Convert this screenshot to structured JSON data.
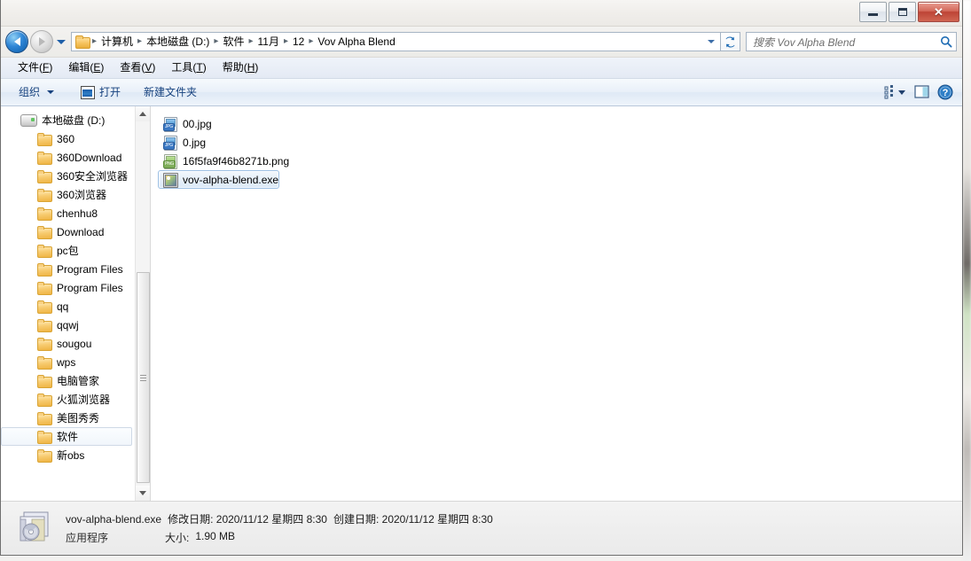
{
  "window": {
    "title": "",
    "controls": {
      "minimize": "—",
      "maximize": "❐",
      "close": "✕"
    }
  },
  "navigation": {
    "back_label": "后退",
    "forward_label": "前进",
    "history_label": "最近的位置",
    "refresh_label": "刷新",
    "breadcrumb_separator": "▸",
    "breadcrumbs": [
      "计算机",
      "本地磁盘 (D:)",
      "软件",
      "11月",
      "12",
      "Vov Alpha Blend"
    ]
  },
  "search": {
    "placeholder": "搜索 Vov Alpha Blend",
    "value": ""
  },
  "menubar": {
    "items": [
      {
        "text": "文件(F)",
        "pre": "文件(",
        "key": "F",
        "post": ")"
      },
      {
        "text": "编辑(E)",
        "pre": "编辑(",
        "key": "E",
        "post": ")"
      },
      {
        "text": "查看(V)",
        "pre": "查看(",
        "key": "V",
        "post": ")"
      },
      {
        "text": "工具(T)",
        "pre": "工具(",
        "key": "T",
        "post": ")"
      },
      {
        "text": "帮助(H)",
        "pre": "帮助(",
        "key": "H",
        "post": ")"
      }
    ]
  },
  "toolbar": {
    "organize_label": "组织",
    "open_label": "打开",
    "new_folder_label": "新建文件夹",
    "view_label": "更改您的视图",
    "preview_label": "显示预览窗格",
    "help_label": "获取帮助"
  },
  "sidebar": {
    "root": {
      "label": "本地磁盘 (D:)",
      "icon": "drive-icon"
    },
    "items": [
      {
        "label": "360",
        "selected": false
      },
      {
        "label": "360Download",
        "selected": false
      },
      {
        "label": "360安全浏览器",
        "selected": false
      },
      {
        "label": "360浏览器",
        "selected": false
      },
      {
        "label": "chenhu8",
        "selected": false
      },
      {
        "label": "Download",
        "selected": false
      },
      {
        "label": "pc包",
        "selected": false
      },
      {
        "label": "Program Files",
        "selected": false
      },
      {
        "label": "Program Files",
        "selected": false
      },
      {
        "label": "qq",
        "selected": false
      },
      {
        "label": "qqwj",
        "selected": false
      },
      {
        "label": "sougou",
        "selected": false
      },
      {
        "label": "wps",
        "selected": false
      },
      {
        "label": "电脑管家",
        "selected": false
      },
      {
        "label": "火狐浏览器",
        "selected": false
      },
      {
        "label": "美图秀秀",
        "selected": false
      },
      {
        "label": "软件",
        "selected": true
      },
      {
        "label": "新obs",
        "selected": false
      }
    ]
  },
  "files": [
    {
      "name": "00.jpg",
      "icon": "jpg-file-icon",
      "type": "jpg",
      "selected": false
    },
    {
      "name": "0.jpg",
      "icon": "jpg-file-icon",
      "type": "jpg",
      "selected": false
    },
    {
      "name": "16f5fa9f46b8271b.png",
      "icon": "png-file-icon",
      "type": "png",
      "selected": false
    },
    {
      "name": "vov-alpha-blend.exe",
      "icon": "exe-file-icon",
      "type": "exe",
      "selected": true
    }
  ],
  "details": {
    "filename": "vov-alpha-blend.exe",
    "modified_label": "修改日期:",
    "modified_value": "2020/11/12 星期四 8:30",
    "created_label": "创建日期:",
    "created_value": "2020/11/12 星期四 8:30",
    "filetype": "应用程序",
    "size_label": "大小:",
    "size_value": "1.90 MB"
  },
  "colors": {
    "accent": "#15417e",
    "selection_border": "#9dc0e4",
    "close_button": "#bd4436",
    "folder": "#efb443"
  }
}
